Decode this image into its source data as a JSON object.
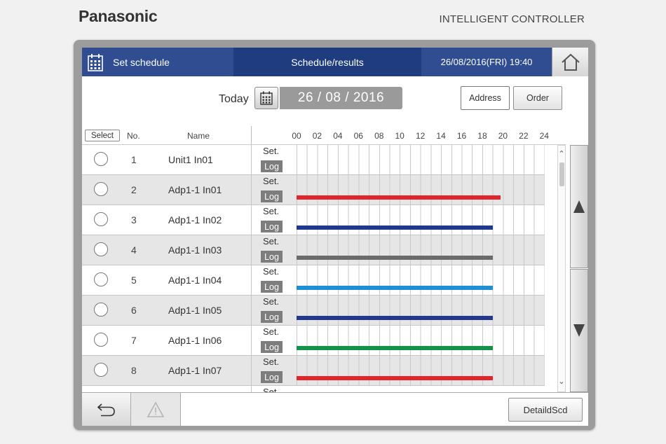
{
  "brand": {
    "logo_text": "Panasonic",
    "subtitle": "INTELLIGENT CONTROLLER"
  },
  "header": {
    "set_schedule_label": "Set schedule",
    "tab_label": "Schedule/results",
    "datetime": "26/08/2016(FRI) 19:40"
  },
  "date_bar": {
    "today_label": "Today",
    "date_value": "26 / 08 / 2016"
  },
  "sort_buttons": {
    "address_label": "Address",
    "order_label": "Order"
  },
  "table": {
    "select_label": "Select",
    "col_no": "No.",
    "col_name": "Name",
    "hours": [
      "00",
      "02",
      "04",
      "06",
      "08",
      "10",
      "12",
      "14",
      "16",
      "18",
      "20",
      "22",
      "24"
    ],
    "set_label": "Set.",
    "log_label": "Log",
    "rows": [
      {
        "no": "1",
        "name": "Unit1 In01",
        "bar": null
      },
      {
        "no": "2",
        "name": "Adp1-1 In01",
        "bar": {
          "start_hour": 0,
          "end_hour": 19.8,
          "color": "#e1262b"
        }
      },
      {
        "no": "3",
        "name": "Adp1-1 In02",
        "bar": {
          "start_hour": 0,
          "end_hour": 19.0,
          "color": "#1e3a8c"
        }
      },
      {
        "no": "4",
        "name": "Adp1-1 In03",
        "bar": {
          "start_hour": 0,
          "end_hour": 19.0,
          "color": "#6b6b6b"
        }
      },
      {
        "no": "5",
        "name": "Adp1-1 In04",
        "bar": {
          "start_hour": 0,
          "end_hour": 19.0,
          "color": "#1e8fd2"
        }
      },
      {
        "no": "6",
        "name": "Adp1-1 In05",
        "bar": {
          "start_hour": 0,
          "end_hour": 19.0,
          "color": "#23388f"
        }
      },
      {
        "no": "7",
        "name": "Adp1-1 In06",
        "bar": {
          "start_hour": 0,
          "end_hour": 19.0,
          "color": "#14924a"
        }
      },
      {
        "no": "8",
        "name": "Adp1-1 In07",
        "bar": {
          "start_hour": 0,
          "end_hour": 19.0,
          "color": "#e1262b"
        }
      }
    ],
    "partial_row_set_label": "Set."
  },
  "icons": {
    "calendar": "calendar-icon",
    "home": "home-icon",
    "back": "back-arrow-icon",
    "warning": "warning-icon",
    "scroll_up": "triangle-up-icon",
    "scroll_down": "triangle-down-icon"
  },
  "footer": {
    "detail_label": "DetaildScd"
  }
}
